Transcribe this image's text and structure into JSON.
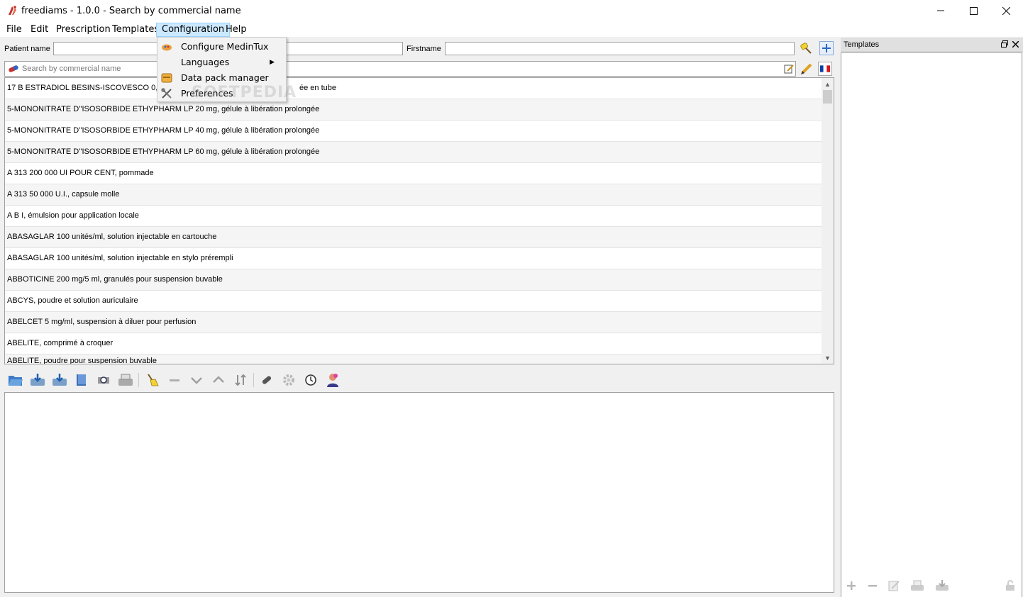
{
  "window": {
    "title": "freediams - 1.0.0 - Search by commercial name",
    "app_icon": "freediams-logo-icon",
    "controls": {
      "minimize": "—",
      "maximize": "☐",
      "close": "✕"
    }
  },
  "menubar": {
    "items": [
      {
        "label": "File"
      },
      {
        "label": "Edit"
      },
      {
        "label": "Prescription"
      },
      {
        "label": "Templates"
      },
      {
        "label": "Configuration",
        "active": true
      },
      {
        "label": "Help"
      }
    ]
  },
  "configuration_menu": {
    "items": [
      {
        "label": "Configure MedinTux",
        "icon": "medintux-icon"
      },
      {
        "label": "Languages",
        "icon": "",
        "submenu": true
      },
      {
        "label": "Data pack manager",
        "icon": "data-pack-icon"
      },
      {
        "label": "Preferences",
        "icon": "tools-icon"
      }
    ],
    "submenu_arrow": "▶"
  },
  "patient": {
    "name_label": "Patient name",
    "name_value": "",
    "firstname_label": "Firstname",
    "firstname_value": ""
  },
  "search": {
    "placeholder": "Search by commercial name",
    "language_flag": "french-flag-icon"
  },
  "druglist": {
    "rows": [
      "17 B ESTRADIOL BESINS-ISCOVESCO 0,06 P",
      "5-MONONITRATE D''ISOSORBIDE ETHYPHARM LP 20 mg, gélule à libération prolongée",
      "5-MONONITRATE D''ISOSORBIDE ETHYPHARM LP 40 mg, gélule à libération prolongée",
      "5-MONONITRATE D''ISOSORBIDE ETHYPHARM LP 60 mg, gélule à libération prolongée",
      "A 313 200 000 UI POUR CENT, pommade",
      "A 313 50 000 U.I., capsule molle",
      "A B I, émulsion pour application locale",
      "ABASAGLAR 100 unités/ml, solution injectable en cartouche",
      "ABASAGLAR 100 unités/ml, solution injectable en stylo prérempli",
      "ABBOTICINE 200 mg/5 ml, granulés pour suspension buvable",
      "ABCYS, poudre et solution auriculaire",
      "ABELCET 5 mg/ml, suspension à diluer pour perfusion",
      "ABELITE, comprimé à croquer",
      "ABELITE, poudre pour suspension buvable"
    ],
    "first_row_tail": "ée en tube"
  },
  "templates_panel": {
    "title": "Templates"
  },
  "watermark": "SOFTPEDIA",
  "colors": {
    "menu_active_bg": "#cce8ff",
    "menu_active_border": "#99d1ff",
    "accent_blue": "#2a66c8"
  }
}
